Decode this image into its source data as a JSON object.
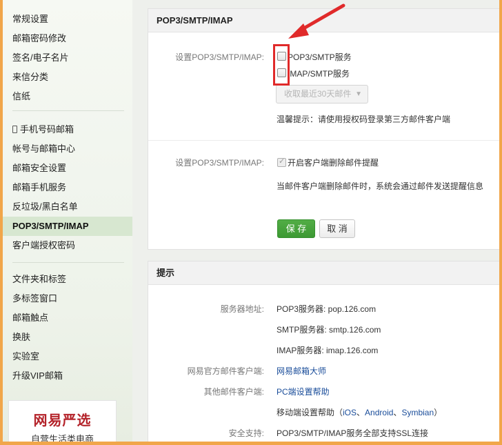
{
  "sidebar": {
    "items": [
      {
        "label": "常规设置"
      },
      {
        "label": "邮箱密码修改"
      },
      {
        "label": "签名/电子名片"
      },
      {
        "label": "来信分类"
      },
      {
        "label": "信纸"
      },
      {
        "label": "手机号码邮箱"
      },
      {
        "label": "帐号与邮箱中心"
      },
      {
        "label": "邮箱安全设置"
      },
      {
        "label": "邮箱手机服务"
      },
      {
        "label": "反垃圾/黑白名单"
      },
      {
        "label": "POP3/SMTP/IMAP"
      },
      {
        "label": "客户端授权密码"
      },
      {
        "label": "文件夹和标签"
      },
      {
        "label": "多标签窗口"
      },
      {
        "label": "邮箱触点"
      },
      {
        "label": "换肤"
      },
      {
        "label": "实验室"
      },
      {
        "label": "升级VIP邮箱"
      }
    ],
    "promo": {
      "brand": "网易严选",
      "sub": "自营生活类电商"
    }
  },
  "settings_panel": {
    "title": "POP3/SMTP/IMAP",
    "row1_label": "设置POP3/SMTP/IMAP:",
    "pop3_option": "POP3/SMTP服务",
    "pop3_checked": false,
    "imap_option": "IMAP/SMTP服务",
    "imap_checked": false,
    "select_value": "收取最近30天邮件",
    "tip": "温馨提示：请使用授权码登录第三方邮件客户端",
    "row2_label": "设置POP3/SMTP/IMAP:",
    "delete_option": "开启客户端删除邮件提醒",
    "delete_checked": true,
    "delete_note": "当邮件客户端删除邮件时，系统会通过邮件发送提醒信息",
    "save": "保 存",
    "cancel": "取 消"
  },
  "tips_panel": {
    "title": "提示",
    "server_label": "服务器地址:",
    "pop3_server": "POP3服务器: pop.126.com",
    "smtp_server": "SMTP服务器: smtp.126.com",
    "imap_server": "IMAP服务器: imap.126.com",
    "official_label": "网易官方邮件客户端:",
    "official_link": "网易邮箱大师",
    "other_label": "其他邮件客户端:",
    "pc_link": "PC端设置帮助",
    "mobile_prefix": "移动端设置帮助（",
    "ios": "iOS",
    "android": "Android",
    "symbian": "Symbian",
    "mobile_suffix": "）",
    "security_label": "安全支持:",
    "security_text": "POP3/SMTP/IMAP服务全部支持SSL连接"
  },
  "colors": {
    "accent": "#e02a2a",
    "frame": "#f1a64a",
    "save": "#3c9933",
    "link": "#1a4d9a"
  }
}
